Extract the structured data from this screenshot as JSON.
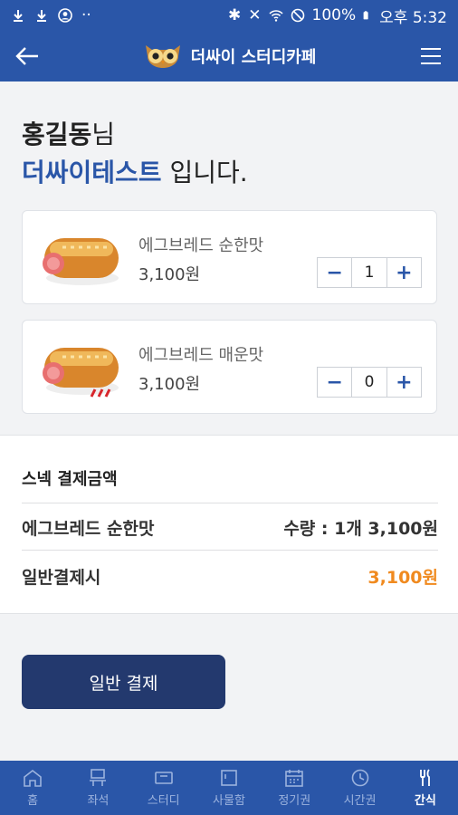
{
  "status_bar": {
    "battery": "100%",
    "time": "오후 5:32",
    "icons": [
      "download-icon",
      "download-icon",
      "account-circle-icon",
      "more-icon",
      "bluetooth-icon",
      "mute-icon",
      "wifi-icon",
      "do-not-disturb-icon",
      "battery-icon"
    ]
  },
  "header": {
    "brand": "더싸이 스터디카페",
    "back_icon": "arrow-left-icon",
    "menu_icon": "hamburger-icon",
    "logo_icon": "owl-logo-icon"
  },
  "greeting": {
    "user": "홍길동",
    "honorific": "님",
    "cafe": "더싸이테스트",
    "suffix": " 입니다."
  },
  "products": [
    {
      "name": "에그브레드 순한맛",
      "price": "3,100원",
      "qty": "1",
      "image_icon": "egg-bread-image"
    },
    {
      "name": "에그브레드 매운맛",
      "price": "3,100원",
      "qty": "0",
      "image_icon": "egg-bread-spicy-image"
    }
  ],
  "stepper": {
    "minus": "−",
    "plus": "+"
  },
  "summary": {
    "title": "스넥 결제금액",
    "item_name": "에그브레드 순한맛",
    "item_detail": "수량 : 1개 3,100원",
    "total_label": "일반결제시",
    "total_value": "3,100원",
    "accent_color": "#f08a1f"
  },
  "pay_button": "일반 결제",
  "tabs": [
    {
      "label": "홈",
      "icon": "home-icon",
      "active": false
    },
    {
      "label": "좌석",
      "icon": "seat-icon",
      "active": false
    },
    {
      "label": "스터디",
      "icon": "study-icon",
      "active": false
    },
    {
      "label": "사물함",
      "icon": "locker-icon",
      "active": false
    },
    {
      "label": "정기권",
      "icon": "calendar-icon",
      "active": false
    },
    {
      "label": "시간권",
      "icon": "clock-icon",
      "active": false
    },
    {
      "label": "간식",
      "icon": "snack-icon",
      "active": true
    }
  ],
  "colors": {
    "primary": "#2a56a8",
    "button": "#23396e",
    "accent": "#f08a1f"
  }
}
